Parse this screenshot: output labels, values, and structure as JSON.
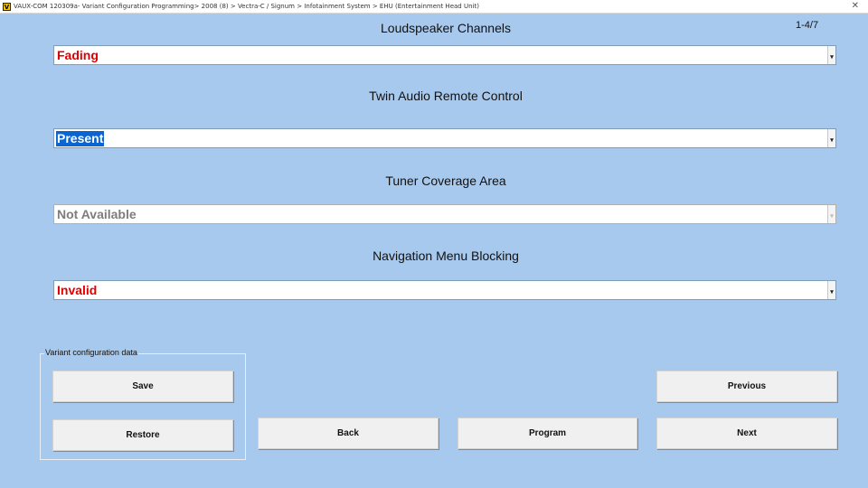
{
  "window": {
    "app_icon_letter": "V",
    "title": "VAUX-COM 120309a- Variant Configuration Programming> 2008 (8) > Vectra-C / Signum > Infotainment System > EHU (Entertainment Head Unit)",
    "close_glyph": "✕"
  },
  "page_indicator": "1-4/7",
  "settings": [
    {
      "title": "Loudspeaker Channels",
      "value": "Fading"
    },
    {
      "title": "Twin Audio Remote Control",
      "value": "Present"
    },
    {
      "title": "Tuner Coverage Area",
      "value": "Not Available"
    },
    {
      "title": "Navigation Menu Blocking",
      "value": "Invalid"
    }
  ],
  "colors": {
    "background": "#a8c9ee",
    "error_value": "#e00000",
    "selection": "#0a64d2",
    "disabled_value": "#7d7d7d"
  },
  "variant_group": {
    "label": "Variant configuration data",
    "save_label": "Save",
    "restore_label": "Restore"
  },
  "nav": {
    "back_label": "Back",
    "program_label": "Program",
    "previous_label": "Previous",
    "next_label": "Next"
  }
}
